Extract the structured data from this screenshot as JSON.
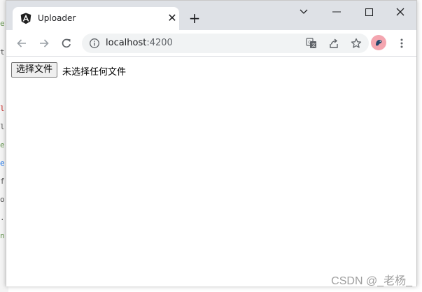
{
  "background_code": {
    "lines": [
      {
        "text": "e",
        "color": "#6a9955"
      },
      {
        "text": "t",
        "color": "#555555"
      },
      {
        "text": "l",
        "color": "#c5221f"
      },
      {
        "text": "l",
        "color": "#555555"
      },
      {
        "text": "e",
        "color": "#6a9955"
      },
      {
        "text": "e",
        "color": "#1a73e8"
      },
      {
        "text": "f",
        "color": "#555555"
      },
      {
        "text": "o",
        "color": "#555555"
      },
      {
        "text": ".",
        "color": "#555555"
      },
      {
        "text": "n",
        "color": "#6a9955"
      }
    ]
  },
  "browser": {
    "tab": {
      "title": "Uploader",
      "favicon": "angular-logo-icon",
      "close_label": "✕"
    },
    "new_tab_label": "+",
    "window_controls": [
      "chevron-down-icon",
      "minimize-icon",
      "maximize-icon",
      "close-icon"
    ],
    "toolbar": {
      "back": "back-arrow-icon",
      "forward": "forward-arrow-icon",
      "reload": "reload-icon",
      "url_host": "localhost",
      "url_port": ":4200",
      "actions": [
        "translate-icon",
        "share-icon",
        "bookmark-star-icon"
      ],
      "profile": "profile-avatar",
      "menu": "more-vert-icon"
    },
    "colors": {
      "tabstrip": "#dee1e6",
      "omnibox": "#f1f3f4",
      "avatar": "#f4a6b0"
    }
  },
  "page": {
    "file_button_label": "选择文件",
    "file_status": "未选择任何文件"
  },
  "watermark": "CSDN @_老杨_"
}
